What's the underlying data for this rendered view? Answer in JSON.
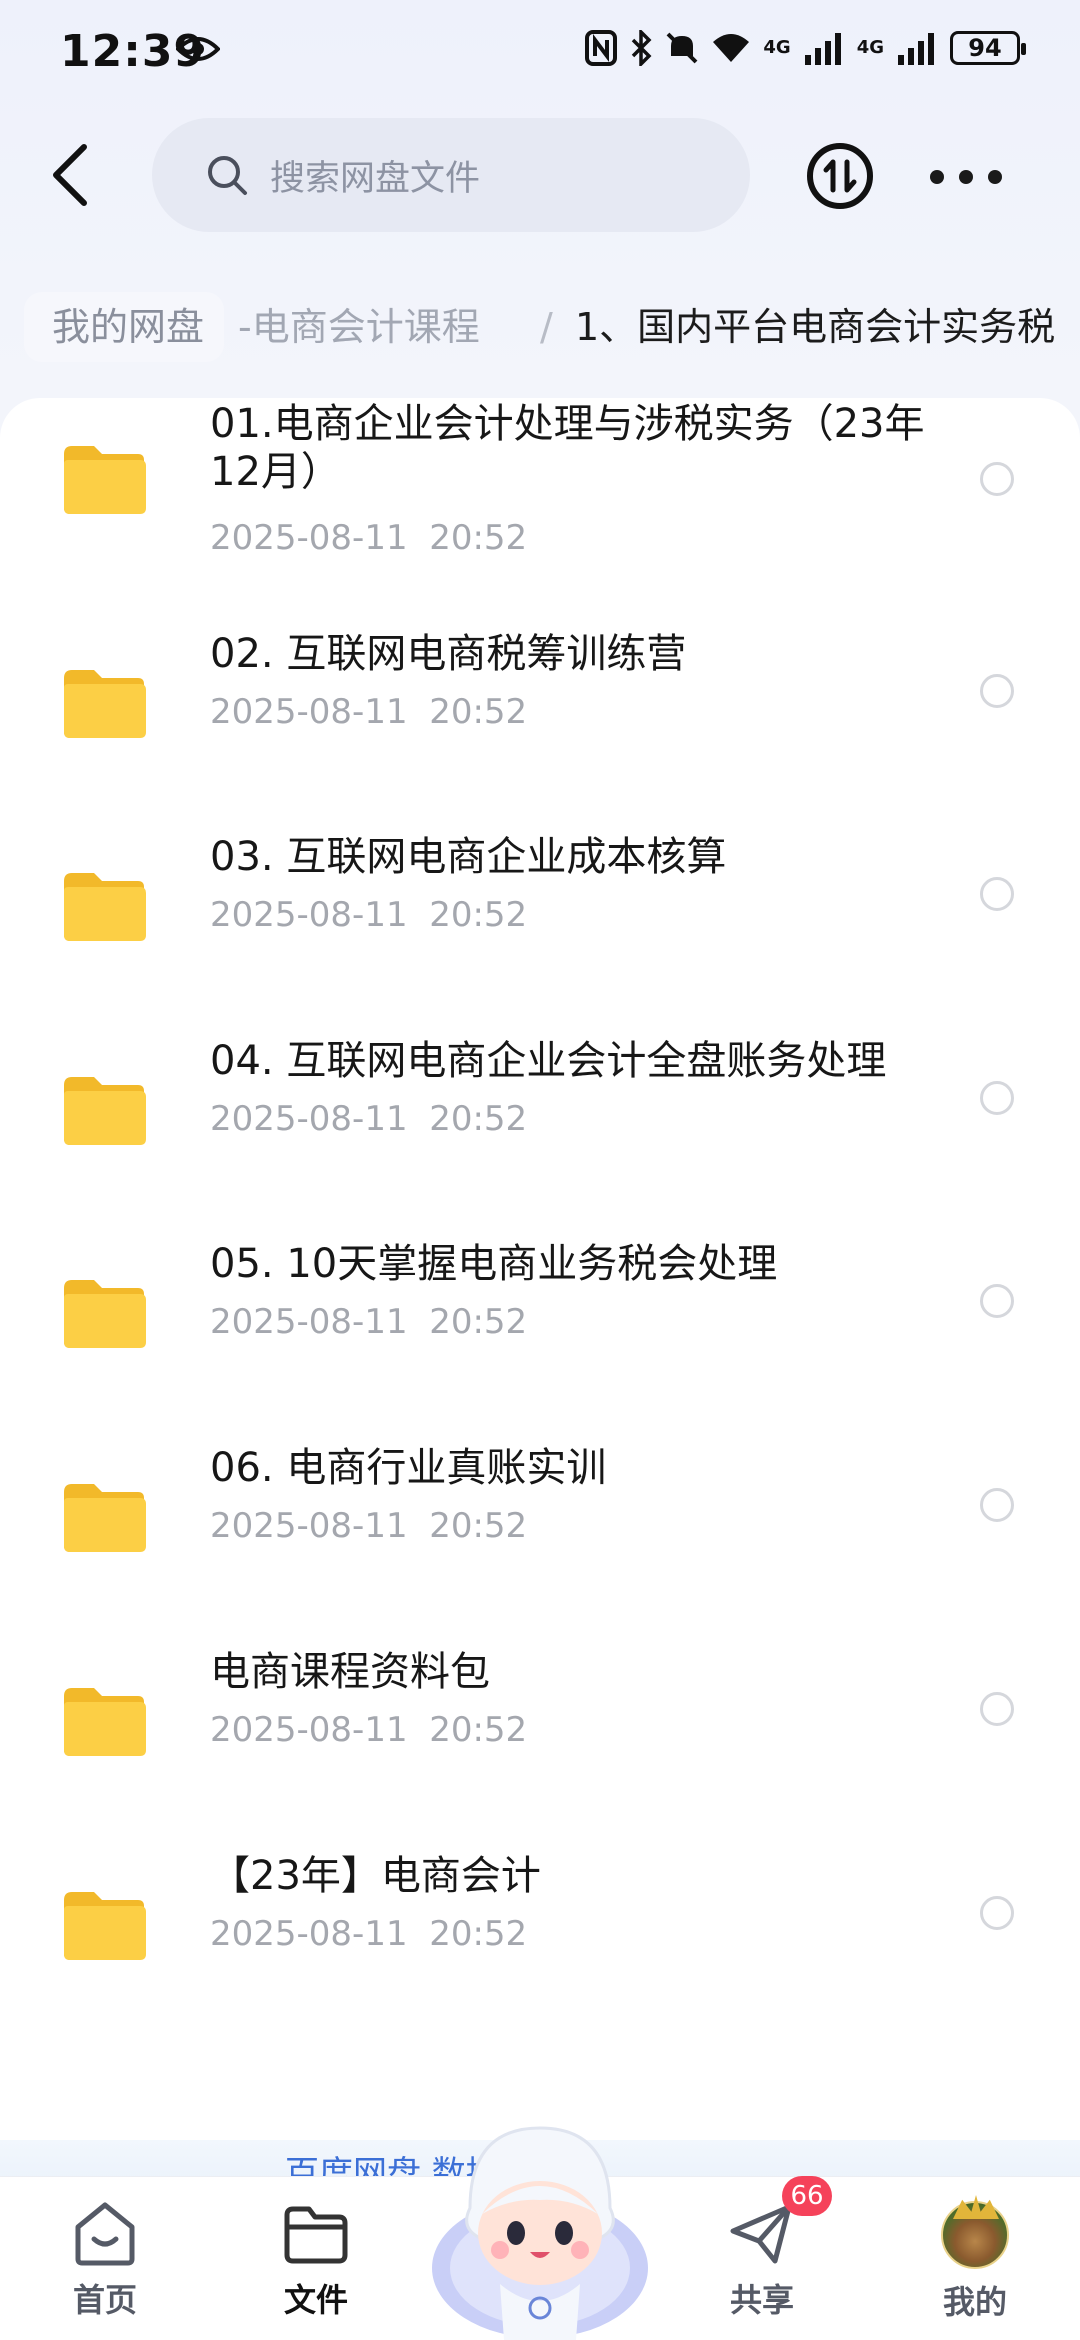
{
  "status_bar": {
    "time": "12:39",
    "network_1": "4G",
    "network_2": "4G",
    "battery": "94"
  },
  "header": {
    "search_placeholder": "搜索网盘文件",
    "icons": [
      "back-arrow-icon",
      "search-icon",
      "transfer-icon",
      "more-icon"
    ]
  },
  "breadcrumb": {
    "root": "我的网盘",
    "middle": "-电商会计课程",
    "separator": "/",
    "current": "1、国内平台电商会计实务税"
  },
  "files": [
    {
      "name": "01.电商企业会计处理与涉税实务（23年12月）",
      "time": "2025-08-11  20:52"
    },
    {
      "name": "02. 互联网电商税筹训练营",
      "time": "2025-08-11  20:52"
    },
    {
      "name": "03. 互联网电商企业成本核算",
      "time": "2025-08-11  20:52"
    },
    {
      "name": "04. 互联网电商企业会计全盘账务处理",
      "time": "2025-08-11  20:52"
    },
    {
      "name": "05. 10天掌握电商业务税会处理",
      "time": "2025-08-11  20:52"
    },
    {
      "name": "06. 电商行业真账实训",
      "time": "2025-08-11  20:52"
    },
    {
      "name": "电商课程资料包",
      "time": "2025-08-11  20:52"
    },
    {
      "name": "【23年】电商会计",
      "time": "2025-08-11  20:52"
    }
  ],
  "banner": {
    "text": "百度网盘                数据安全 ›"
  },
  "bottom_nav": {
    "home": "首页",
    "files": "文件",
    "share": "共享",
    "share_badge": "66",
    "mine": "我的"
  },
  "colors": {
    "folder": "#f9c83a",
    "badge": "#f5425a",
    "accent": "#3b6fd6"
  }
}
